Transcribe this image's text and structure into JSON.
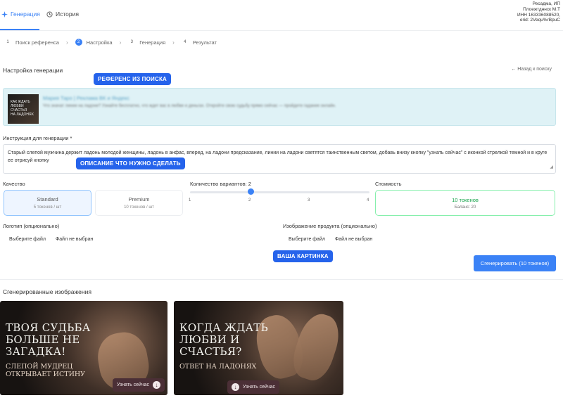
{
  "tabs": [
    {
      "label": "Генерация",
      "icon": "sparkle-icon",
      "active": true
    },
    {
      "label": "История",
      "icon": "clock-icon",
      "active": false
    }
  ],
  "account": [
    "Ресадма, ИП",
    "Плоежтдннск М.Т",
    "ИНН 163336088520,",
    "erid: 2Vequ%rBpuC"
  ],
  "steps": [
    {
      "num": "1",
      "label": "Поиск референса",
      "active": false
    },
    {
      "num": "2",
      "label": "Настройка",
      "active": true
    },
    {
      "num": "3",
      "label": "Генерация",
      "active": false
    },
    {
      "num": "4",
      "label": "Результат",
      "active": false
    }
  ],
  "settings_title": "Настройка генерации",
  "back_link": "← Назад к поиску",
  "callouts": {
    "reference": "РЕФЕРЕНС ИЗ ПОИСКА",
    "instruction": "ОПИСАНИЕ ЧТО НУЖНО СДЕЛАТЬ",
    "picture": "ВАША КАРТИНКА"
  },
  "reference": {
    "thumb_text": [
      "КАК ЖДАТЬ",
      "ЛЮБВИ",
      "СЧАСТЬЯ",
      "НА ЛАДОНЯХ"
    ],
    "title": "Мария Таро | Реклама ВК и Яндекс",
    "description": "Что значат линии на ладони? Узнайте бесплатно, что ждет вас в любви и деньгах. Откройте свою судьбу прямо сейчас — пройдите гадание онлайн."
  },
  "instruction": {
    "label": "Инструкция для генерации *",
    "value": "Старый слепой мужчина держит ладонь молодой женщины, ладонь в анфас, вперед, на ладони предсказание, линии на ладони светятся таинственным светом, добавь внизу кнопку \"узнать сейчас\" с иконкой стрелкой темной и в круге ее отрисуй кнопку"
  },
  "quality": {
    "label": "Качество",
    "options": [
      {
        "name": "Standard",
        "sub": "5 токенов / шт"
      },
      {
        "name": "Premium",
        "sub": "10 токенов / шт"
      }
    ]
  },
  "variants": {
    "label": "Количество вариантов: 2",
    "value": 2,
    "ticks": [
      "1",
      "2",
      "3",
      "4"
    ]
  },
  "cost": {
    "label": "Стоимость",
    "main": "10 токенов",
    "sub": "Баланс: 20"
  },
  "logo_field": {
    "label": "Логотип (опционально)",
    "button": "Выберите файл",
    "status": "Файл не выбран"
  },
  "product_field": {
    "label": "Изображение продукта (опционально)",
    "button": "Выберите файл",
    "status": "Файл не выбран"
  },
  "generate_button": "Сгенерировать (10 токенов)",
  "generated_title": "Сгенерированные изображения",
  "generated": [
    {
      "headline": [
        "ТВОЯ СУДЬБА",
        "БОЛЬШЕ НЕ",
        "ЗАГАДКА!"
      ],
      "sub": [
        "СЛЕПОЙ МУДРЕЦ",
        "ОТКРЫВАЕТ ИСТИНУ"
      ],
      "cta": "Узнать сейчас"
    },
    {
      "headline": [
        "КОГДА ЖДАТЬ",
        "ЛЮБВИ И",
        "СЧАСТЬЯ?"
      ],
      "sub": [
        "ОТВЕТ НА ЛАДОНЯХ"
      ],
      "cta": "Узнать сейчас"
    }
  ]
}
